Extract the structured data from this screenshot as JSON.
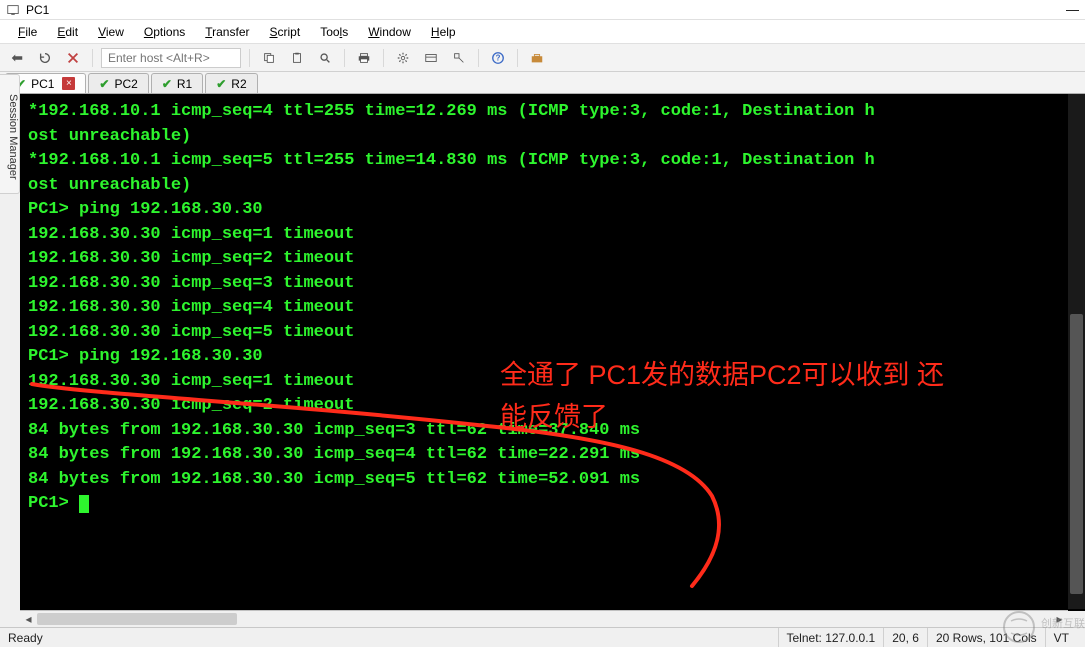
{
  "window": {
    "title": "PC1"
  },
  "menu": [
    "File",
    "Edit",
    "View",
    "Options",
    "Transfer",
    "Script",
    "Tools",
    "Window",
    "Help"
  ],
  "hostbox_placeholder": "Enter host <Alt+R>",
  "tabs": [
    {
      "label": "PC1",
      "active": true,
      "closeable": true
    },
    {
      "label": "PC2",
      "active": false,
      "closeable": false
    },
    {
      "label": "R1",
      "active": false,
      "closeable": false
    },
    {
      "label": "R2",
      "active": false,
      "closeable": false
    }
  ],
  "side_tab": "Session Manager",
  "terminal_lines": [
    "*192.168.10.1 icmp_seq=4 ttl=255 time=12.269 ms (ICMP type:3, code:1, Destination h",
    "ost unreachable)",
    "*192.168.10.1 icmp_seq=5 ttl=255 time=14.830 ms (ICMP type:3, code:1, Destination h",
    "ost unreachable)",
    "",
    "PC1> ping 192.168.30.30",
    "192.168.30.30 icmp_seq=1 timeout",
    "192.168.30.30 icmp_seq=2 timeout",
    "192.168.30.30 icmp_seq=3 timeout",
    "192.168.30.30 icmp_seq=4 timeout",
    "192.168.30.30 icmp_seq=5 timeout",
    "",
    "PC1> ping 192.168.30.30",
    "192.168.30.30 icmp_seq=1 timeout",
    "192.168.30.30 icmp_seq=2 timeout",
    "84 bytes from 192.168.30.30 icmp_seq=3 ttl=62 time=37.840 ms",
    "84 bytes from 192.168.30.30 icmp_seq=4 ttl=62 time=22.291 ms",
    "84 bytes from 192.168.30.30 icmp_seq=5 ttl=62 time=52.091 ms",
    "",
    "PC1> "
  ],
  "annotation_l1": "全通了 PC1发的数据PC2可以收到 还",
  "annotation_l2": "能反馈了",
  "status": {
    "ready": "Ready",
    "conn": "Telnet: 127.0.0.1",
    "cursor": "20,  6",
    "size": "20 Rows, 101 Cols",
    "term": "VT"
  },
  "watermark": "创新互联"
}
